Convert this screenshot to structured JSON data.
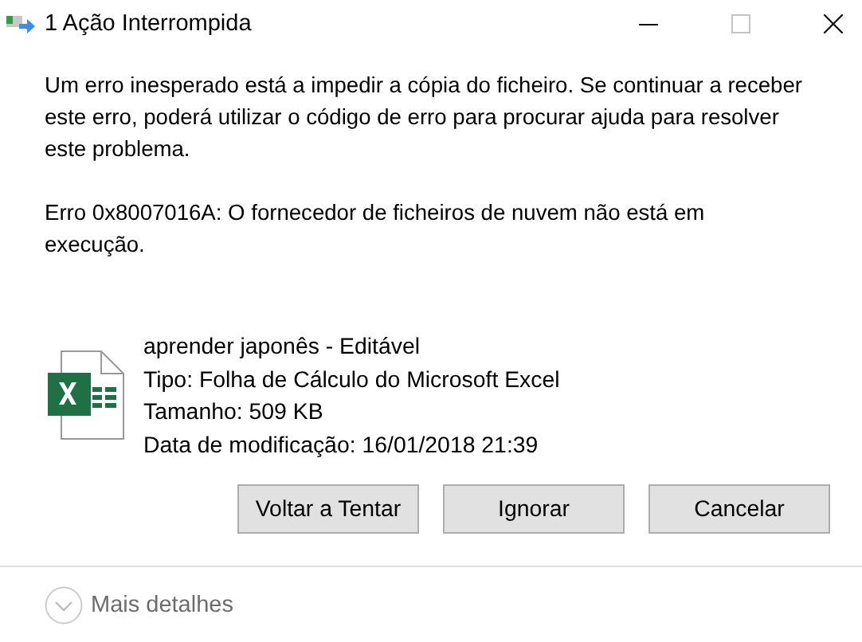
{
  "window": {
    "title": "1 Ação Interrompida"
  },
  "message": "Um erro inesperado está a impedir a cópia do ficheiro. Se continuar a receber este erro, poderá utilizar o código de erro para procurar ajuda para resolver este problema.",
  "error": "Erro 0x8007016A: O fornecedor de ficheiros de nuvem não está em execução.",
  "file": {
    "name": "aprender japonês - Editável",
    "details": [
      "Tipo: Folha de Cálculo do Microsoft Excel",
      "Tamanho: 509 KB",
      "Data de modificação: 16/01/2018 21:39"
    ]
  },
  "buttons": [
    "Voltar a Tentar",
    "Ignorar",
    "Cancelar"
  ],
  "more_details": {
    "label": "Mais detalhes",
    "expanded": false
  }
}
